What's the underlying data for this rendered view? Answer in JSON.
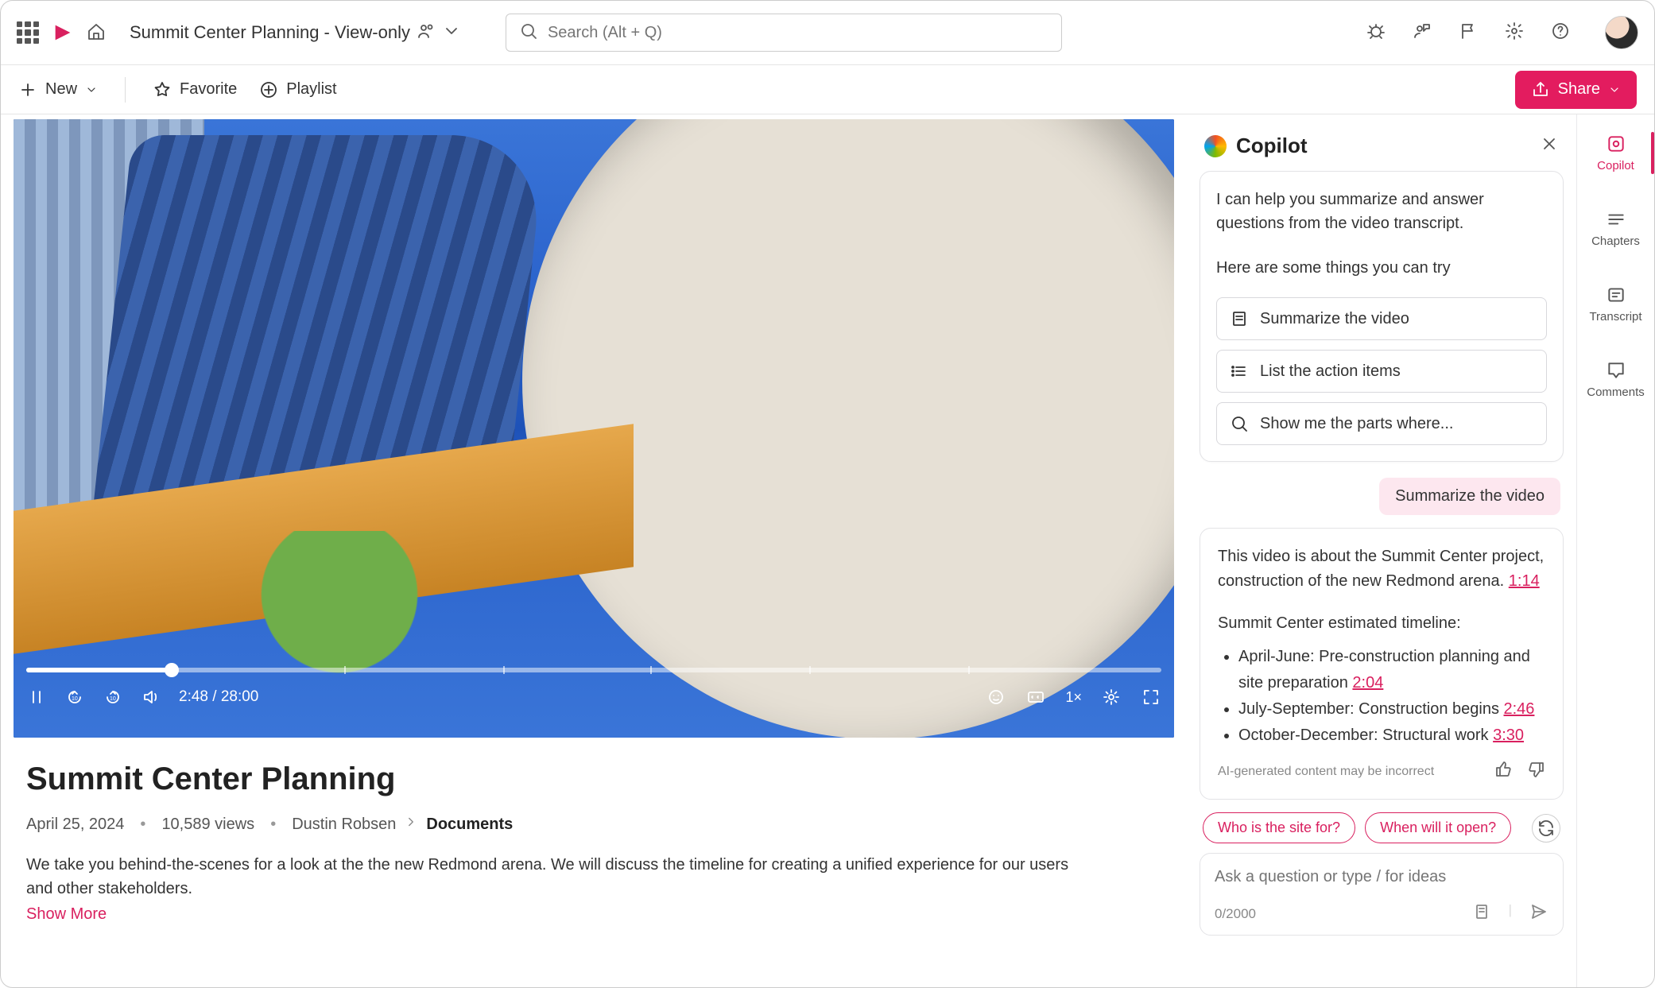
{
  "header": {
    "doc_title": "Summit Center Planning - View-only",
    "search_placeholder": "Search (Alt + Q)"
  },
  "toolbar": {
    "new_label": "New",
    "favorite_label": "Favorite",
    "playlist_label": "Playlist",
    "share_label": "Share"
  },
  "player": {
    "current_time": "2:48",
    "duration": "28:00",
    "time_display": "2:48 / 28:00",
    "speed": "1×"
  },
  "video": {
    "title": "Summit Center Planning",
    "date": "April 25, 2024",
    "views": "10,589 views",
    "author": "Dustin Robsen",
    "breadcrumb_last": "Documents",
    "description": "We take you behind-the-scenes for a look at the the new Redmond arena. We will discuss the timeline for creating a unified experience for our users and other stakeholders.",
    "show_more": "Show More"
  },
  "copilot": {
    "title": "Copilot",
    "intro": "I can help you summarize and answer questions from the video transcript.",
    "try_label": "Here are some things you can try",
    "suggestions": {
      "s1": "Summarize the video",
      "s2": "List the action items",
      "s3": "Show me the parts where..."
    },
    "user_msg": "Summarize the video",
    "response": {
      "p1_a": "This video is about the Summit Center project, construction of the new Redmond arena. ",
      "p1_ts": "1:14",
      "p2": "Summit Center estimated timeline:",
      "items": {
        "i1_text": "April-June: Pre-construction planning and site preparation ",
        "i1_ts": "2:04",
        "i2_text": "July-September: Construction begins ",
        "i2_ts": "2:46",
        "i3_text": "October-December: Structural work ",
        "i3_ts": "3:30"
      },
      "disclaimer": "AI-generated content may be incorrect"
    },
    "chips": {
      "c1": "Who is the site for?",
      "c2": "When will it open?"
    },
    "input_placeholder": "Ask a question or type / for ideas",
    "char_count": "0/2000"
  },
  "rail": {
    "copilot": "Copilot",
    "chapters": "Chapters",
    "transcript": "Transcript",
    "comments": "Comments"
  }
}
